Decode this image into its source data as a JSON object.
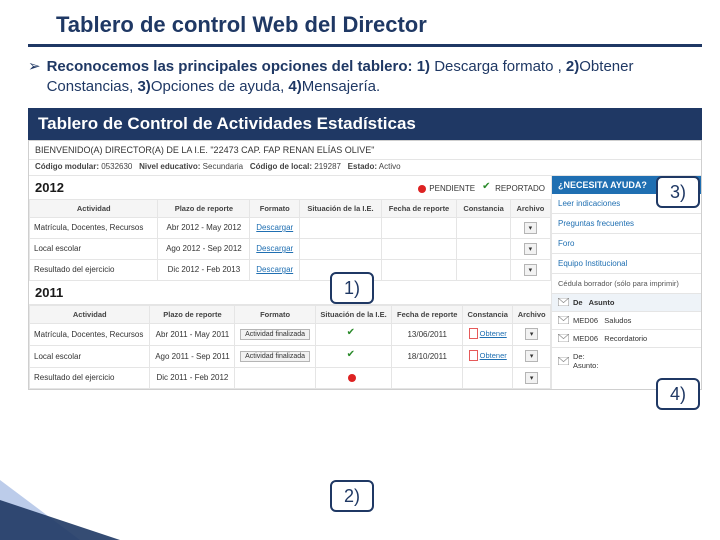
{
  "title": "Tablero de control Web del Director",
  "bullet": {
    "lead": "Reconocemos las principales opciones del tablero: ",
    "p1_num": "1)",
    "p1_txt": " Descarga formato , ",
    "p2_num": "2)",
    "p2_txt": "Obtener Constancias, ",
    "p3_num": "3)",
    "p3_txt": "Opciones de ayuda, ",
    "p4_num": "4)",
    "p4_txt": "Mensajería."
  },
  "panelTitle": "Tablero de Control de Actividades Estadísticas",
  "welcome": "BIENVENIDO(A) DIRECTOR(A) DE LA I.E. \"22473 CAP. FAP RENAN ELÍAS OLIVE\"",
  "meta": {
    "cod_lbl": "Código modular:",
    "cod_val": "0532630",
    "niv_lbl": "Nivel educativo:",
    "niv_val": "Secundaria",
    "loc_lbl": "Código de local:",
    "loc_val": "219287",
    "est_lbl": "Estado:",
    "est_val": "Activo"
  },
  "legend": {
    "pend": "PENDIENTE",
    "rep": "REPORTADO"
  },
  "headers": {
    "actividad": "Actividad",
    "plazo": "Plazo de reporte",
    "formato": "Formato",
    "sit": "Situación de la I.E.",
    "fecha": "Fecha de reporte",
    "const": "Constancia",
    "arch": "Archivo"
  },
  "years": {
    "y2012": "2012",
    "y2011": "2011"
  },
  "rows2012": [
    {
      "act": "Matrícula, Docentes, Recursos",
      "plazo": "Abr 2012 - May 2012",
      "fmt": "Descargar"
    },
    {
      "act": "Local escolar",
      "plazo": "Ago 2012 - Sep 2012",
      "fmt": "Descargar"
    },
    {
      "act": "Resultado del ejercicio",
      "plazo": "Dic 2012 - Feb 2013",
      "fmt": "Descargar"
    }
  ],
  "rows2011": [
    {
      "act": "Matrícula, Docentes, Recursos",
      "plazo": "Abr 2011 - May 2011",
      "fmt": "Actividad finalizada",
      "ok": true,
      "fecha": "13/06/2011",
      "const": "Obtener"
    },
    {
      "act": "Local escolar",
      "plazo": "Ago 2011 - Sep 2011",
      "fmt": "Actividad finalizada",
      "ok": true,
      "fecha": "18/10/2011",
      "const": "Obtener"
    },
    {
      "act": "Resultado del ejercicio",
      "plazo": "Dic 2011 - Feb 2012",
      "fmt": "",
      "pend": true
    }
  ],
  "help": {
    "hdr": "¿NECESITA AYUDA?",
    "items": [
      "Leer indicaciones",
      "Preguntas frecuentes",
      "Foro",
      "Equipo Institucional"
    ],
    "note": "Cédula borrador (sólo para imprimir)"
  },
  "msgs": {
    "hdr_de": "De",
    "hdr_asunto": "Asunto",
    "r1_de": "MED06",
    "r1_as": "Saludos",
    "r2_de": "MED06",
    "r2_as": "Recordatorio",
    "compose_de": "De:",
    "compose_as": "Asunto:"
  },
  "callouts": {
    "c1": "1)",
    "c2": "2)",
    "c3": "3)",
    "c4": "4)"
  }
}
